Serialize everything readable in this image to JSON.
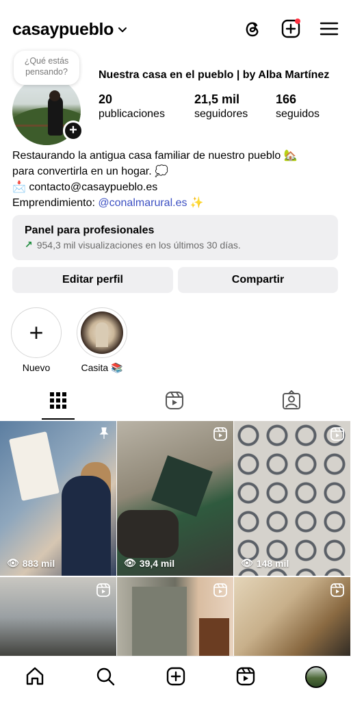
{
  "header": {
    "username": "casaypueblo",
    "icons": [
      "chevron-down-icon",
      "threads-icon",
      "new-post-icon",
      "menu-icon"
    ]
  },
  "profile": {
    "note": "¿Qué estás pensando?",
    "display_name": "Nuestra casa en el pueblo | by Alba Martínez",
    "stats": {
      "posts_value": "20",
      "posts_label": "publicaciones",
      "followers_value": "21,5 mil",
      "followers_label": "seguidores",
      "following_value": "166",
      "following_label": "seguidos"
    },
    "bio": {
      "line1": "Restaurando la antigua casa familiar de nuestro pueblo 🏡",
      "line2": "para convertirla en un hogar. 💭",
      "line3_icon": "📩",
      "line3": "contacto@casaypueblo.es",
      "line4_prefix": "Emprendimiento: ",
      "line4_link": "@conalmarural.es",
      "line4_suffix": " ✨"
    }
  },
  "dashboard": {
    "title": "Panel para profesionales",
    "subtitle": "954,3 mil visualizaciones en los últimos 30 días."
  },
  "buttons": {
    "edit": "Editar perfil",
    "share": "Compartir"
  },
  "highlights": [
    {
      "label": "Nuevo"
    },
    {
      "label": "Casita 📚"
    }
  ],
  "tabs": [
    "grid-tab",
    "reels-tab",
    "tagged-tab"
  ],
  "posts": [
    {
      "views": "883 mil",
      "pinned": true
    },
    {
      "views": "39,4 mil",
      "reel": true
    },
    {
      "views": "148 mil",
      "reel": true
    },
    {
      "reel": true
    },
    {
      "reel": true
    },
    {
      "reel": true
    }
  ],
  "bottom_nav": [
    "home-icon",
    "search-icon",
    "create-icon",
    "reels-icon",
    "profile-avatar"
  ]
}
